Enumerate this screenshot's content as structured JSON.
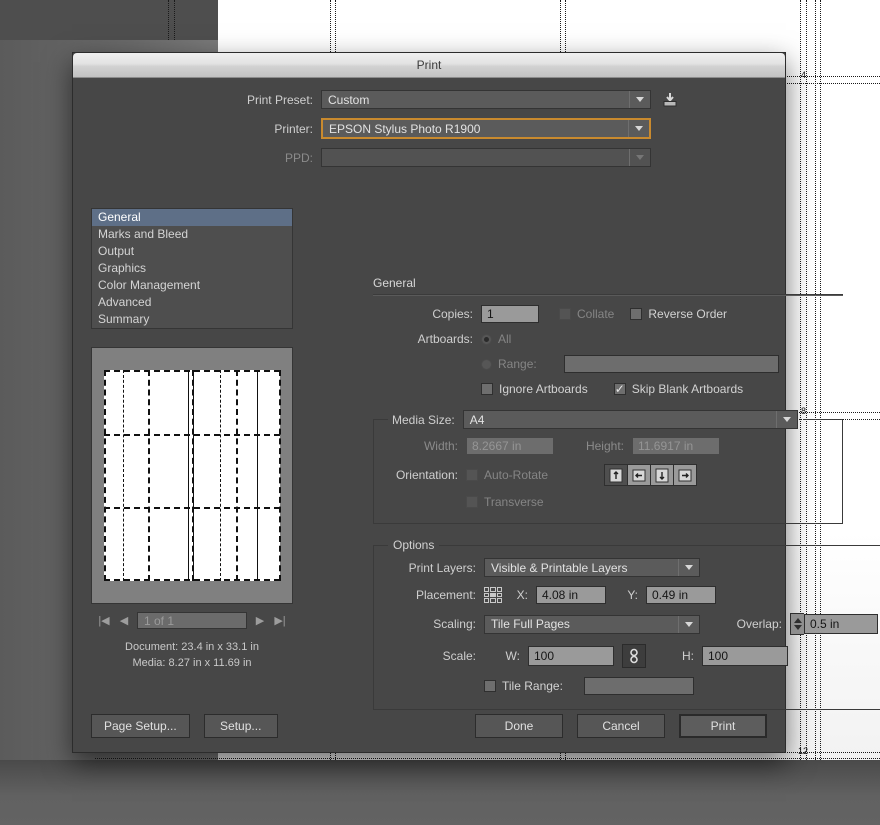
{
  "background": {
    "guide_numbers": [
      "4",
      "8",
      "12",
      "4",
      "8",
      "12"
    ]
  },
  "dialog": {
    "title": "Print",
    "preset_row": {
      "label": "Print Preset:",
      "value": "Custom",
      "save_icon": "save-preset-icon"
    },
    "printer_row": {
      "label": "Printer:",
      "value": "EPSON Stylus Photo R1900"
    },
    "ppd_row": {
      "label": "PPD:",
      "value": ""
    }
  },
  "nav": {
    "items": [
      {
        "label": "General",
        "selected": true
      },
      {
        "label": "Marks and Bleed",
        "selected": false
      },
      {
        "label": "Output",
        "selected": false
      },
      {
        "label": "Graphics",
        "selected": false
      },
      {
        "label": "Color Management",
        "selected": false
      },
      {
        "label": "Advanced",
        "selected": false
      },
      {
        "label": "Summary",
        "selected": false
      }
    ]
  },
  "preview": {
    "first_page_icon": "first-page-icon",
    "prev_page_icon": "prev-page-icon",
    "page_field_value": "1 of 1",
    "next_page_icon": "next-page-icon",
    "last_page_icon": "last-page-icon",
    "document_line": "Document: 23.4 in x 33.1 in",
    "media_line": "Media: 8.27 in x 11.69 in"
  },
  "general": {
    "section_title": "General",
    "copies": {
      "label": "Copies:",
      "value": "1"
    },
    "collate": {
      "label": "Collate",
      "checked": false
    },
    "reverse_order": {
      "label": "Reverse Order",
      "checked": false
    },
    "artboards": {
      "label": "Artboards:",
      "all_label": "All",
      "range_label": "Range:",
      "range_value": ""
    },
    "ignore_artboards": {
      "label": "Ignore Artboards",
      "checked": false
    },
    "skip_blank_artboards": {
      "label": "Skip Blank Artboards",
      "checked": true
    }
  },
  "media": {
    "legend": "Media Size:",
    "size_value": "A4",
    "width": {
      "label": "Width:",
      "value": "8.2667 in"
    },
    "height": {
      "label": "Height:",
      "value": "11.6917 in"
    },
    "orientation": {
      "label": "Orientation:",
      "auto_rotate_label": "Auto-Rotate",
      "auto_rotate_checked": false
    },
    "orientation_buttons": [
      {
        "name": "portrait-up-icon",
        "selected": true
      },
      {
        "name": "landscape-left-icon",
        "selected": false
      },
      {
        "name": "portrait-down-icon",
        "selected": false
      },
      {
        "name": "landscape-right-icon",
        "selected": false
      }
    ],
    "transverse": {
      "label": "Transverse",
      "checked": false
    }
  },
  "options": {
    "legend": "Options",
    "print_layers": {
      "label": "Print Layers:",
      "value": "Visible & Printable Layers"
    },
    "placement": {
      "label": "Placement:",
      "proxy_icon": "placement-proxy-icon",
      "x_label": "X:",
      "x_value": "4.08 in",
      "y_label": "Y:",
      "y_value": "0.49 in"
    },
    "scaling": {
      "label": "Scaling:",
      "value": "Tile Full Pages"
    },
    "overlap": {
      "label": "Overlap:",
      "value": "0.5 in"
    },
    "scale": {
      "label": "Scale:",
      "w_label": "W:",
      "w_value": "100",
      "link_icon": "link-chain-icon",
      "h_label": "H:",
      "h_value": "100"
    },
    "tile_range": {
      "label": "Tile Range:",
      "checked": false,
      "value": ""
    }
  },
  "buttons": {
    "page_setup": "Page Setup...",
    "setup": "Setup...",
    "done": "Done",
    "cancel": "Cancel",
    "print": "Print"
  },
  "colors": {
    "dialog_bg": "#474747",
    "field_bg": "#9a9a9a",
    "selection": "#5e6f87",
    "focus_ring": "#c98a2e"
  }
}
